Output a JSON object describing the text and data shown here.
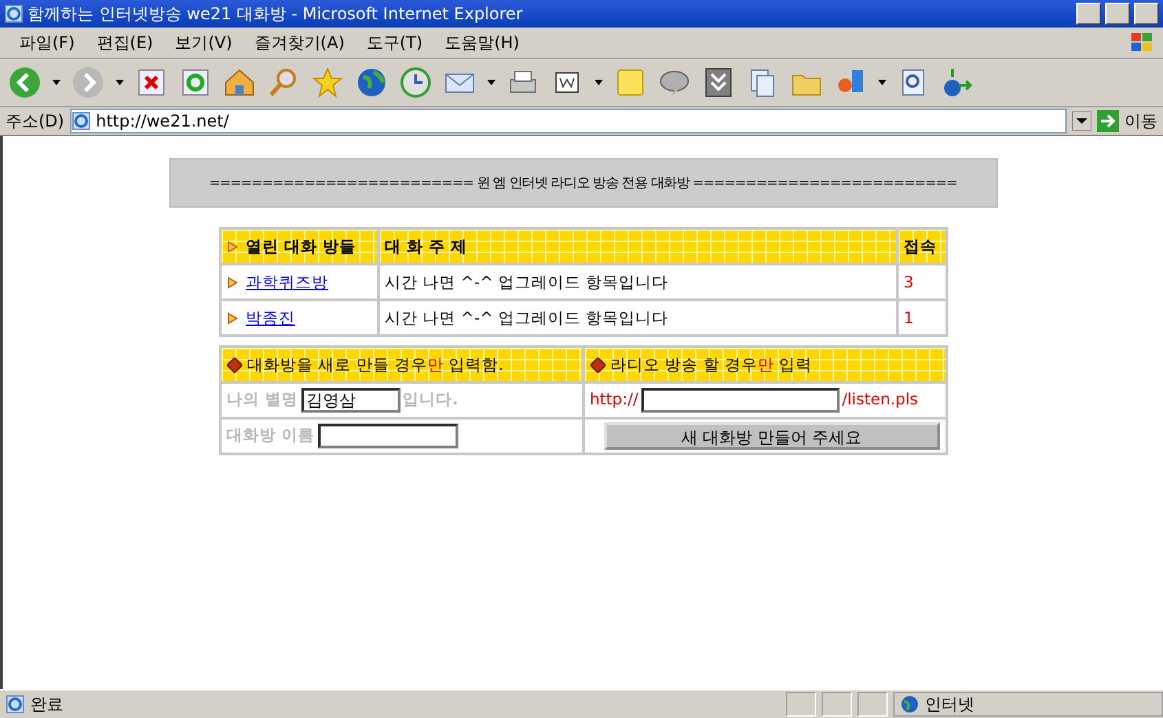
{
  "window": {
    "title": "함께하는 인터넷방송 we21 대화방 - Microsoft Internet Explorer"
  },
  "menu": [
    "파일(F)",
    "편집(E)",
    "보기(V)",
    "즐겨찾기(A)",
    "도구(T)",
    "도움말(H)"
  ],
  "address": {
    "label": "주소(D)",
    "value": "http://we21.net/",
    "go": "이동"
  },
  "banner": "=========================  윈 엠 인터넷 라디오 방송  전용  대화방  =========================",
  "rooms": {
    "columns": [
      "열린 대화 방들",
      "대 화 주 제",
      "접속"
    ],
    "rows": [
      {
        "name": "과학퀴즈방",
        "topic": "시간 나면 ^-^ 업그레이드 항목입니다",
        "count": "3"
      },
      {
        "name": "박종진",
        "topic": "시간 나면 ^-^ 업그레이드 항목입니다",
        "count": "1"
      }
    ]
  },
  "create": {
    "left_header": [
      {
        "text": "대화방을 새로 만들 경우",
        "accent": false
      },
      {
        "text": "만",
        "accent": true
      },
      {
        "text": " 입력함.",
        "accent": false
      }
    ],
    "right_header": [
      {
        "text": "라디오 방송 할 경우",
        "accent": false
      },
      {
        "text": "만",
        "accent": true
      },
      {
        "text": " 입력",
        "accent": false
      }
    ],
    "nick_label": "나의 별명",
    "nick_value": "김영삼",
    "nick_suffix": "입니다.",
    "room_label": "대화방 이름",
    "url_prefix": "http://",
    "url_suffix": "/listen.pls",
    "button": "새 대화방 만들어 주세요"
  },
  "status_bar": {
    "text": "완료",
    "zone": "인터넷"
  }
}
